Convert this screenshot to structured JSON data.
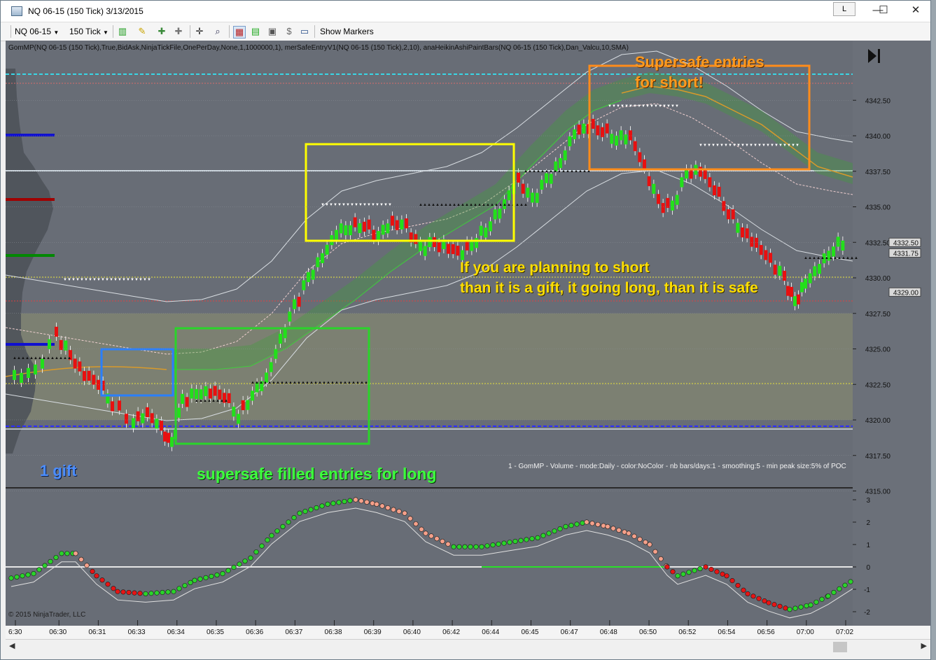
{
  "window": {
    "title": "NQ 06-15 (150 Tick)  3/13/2015",
    "link_button": "L",
    "minimize": "—",
    "maximize": "☐",
    "close": "✕"
  },
  "toolbar": {
    "instrument": "NQ 06-15",
    "interval": "150 Tick",
    "show_markers": "Show Markers",
    "icons": [
      "bar-style-icon",
      "drawing-tool-icon",
      "zoom-in-icon",
      "zoom-out-icon",
      "crosshair-icon",
      "magnifier-icon",
      "indicators-icon",
      "strategies-icon",
      "data-box-icon",
      "properties-icon"
    ]
  },
  "chart": {
    "indicator_label": "GomMP(NQ 06-15 (150 Tick),True,BidAsk,NinjaTickFile,OnePerDay,None,1,1000000,1), merSafeEntryV1(NQ 06-15 (150 Tick),2,10), anaHeikinAshiPaintBars(NQ 06-15 (150 Tick),Dan_Valcu,10,SMA)",
    "gommp_info": "1 - GomMP - Volume - mode:Daily  - color:NoColor - nb bars/days:1 - smoothing:5 - min peak size:5% of POC",
    "copyright": "© 2015 NinjaTrader, LLC",
    "price_ticks": [
      "4342.50",
      "4340.00",
      "4337.50",
      "4335.00",
      "4332.50",
      "4330.00",
      "4327.50",
      "4325.00",
      "4322.50",
      "4320.00",
      "4317.50",
      "4315.00"
    ],
    "price_markers": [
      "4332.50",
      "4331.75",
      "4329.00"
    ],
    "osc_ticks": [
      "3",
      "2",
      "1",
      "0",
      "-1",
      "-2"
    ],
    "time_ticks": [
      "6:30",
      "06:30",
      "06:31",
      "06:33",
      "06:34",
      "06:35",
      "06:36",
      "06:37",
      "06:38",
      "06:39",
      "06:40",
      "06:42",
      "06:44",
      "06:45",
      "06:47",
      "06:48",
      "06:50",
      "06:52",
      "06:54",
      "06:56",
      "07:00",
      "07:02"
    ],
    "colors": {
      "background": "#6b7079",
      "up_candle": "#22e01a",
      "down_candle": "#e81010",
      "yellow_box": "#ffff00",
      "green_box": "#2ad42a",
      "orange_box": "#ff8c1a",
      "blue_box": "#2a7fff"
    }
  },
  "annotations": {
    "short_title_1": "Supersafe entries",
    "short_title_2": "for short!",
    "gift_text_1": "If you are planning to short",
    "gift_text_2": "than it is a gift, it going long, than it is safe",
    "long_text": "supersafe filled entries for long",
    "gift_label": "1 gift"
  }
}
